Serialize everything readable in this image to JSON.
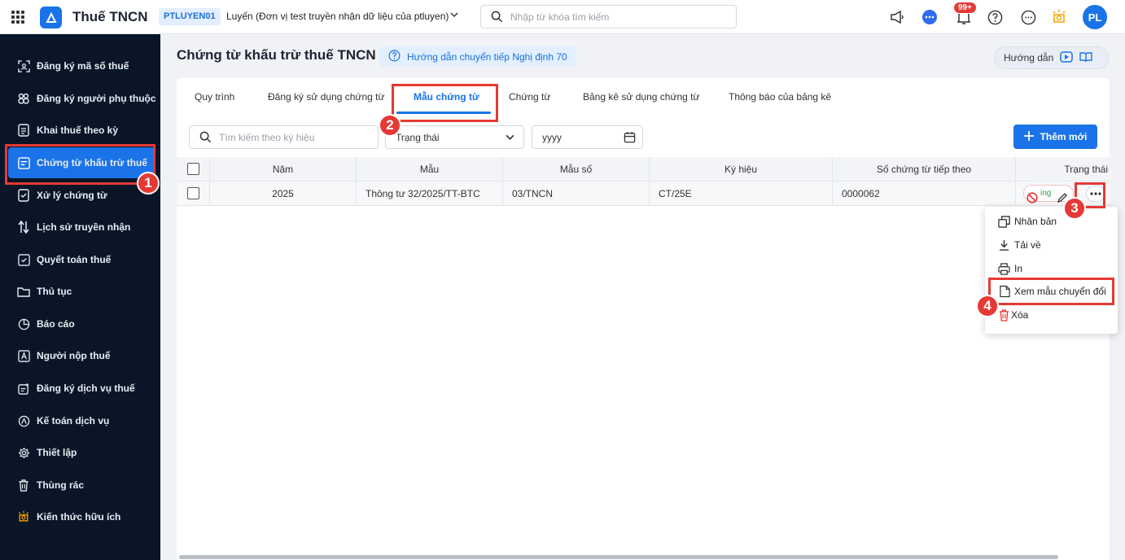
{
  "app": {
    "title": "Thuế TNCN",
    "tax_code": "PTLUYEN01",
    "org_name": "Luyến (Đơn vị test truyền nhận dữ liệu của ptluyen)",
    "search_placeholder": "Nhập từ khóa tìm kiếm",
    "notification_count": "99+",
    "avatar_initials": "PL"
  },
  "sidebar": {
    "items": [
      {
        "label": "Đăng ký mã số thuế",
        "icon": "scan-icon"
      },
      {
        "label": "Đăng ký người phụ thuộc",
        "icon": "people-icon"
      },
      {
        "label": "Khai thuế theo kỳ",
        "icon": "document-icon"
      },
      {
        "label": "Chứng từ khấu trừ thuế",
        "icon": "receipt-icon",
        "active": true
      },
      {
        "label": "Xử lý chứng từ",
        "icon": "doc-check-icon"
      },
      {
        "label": "Lịch sử truyền nhận",
        "icon": "transfer-icon"
      },
      {
        "label": "Quyết toán thuế",
        "icon": "settle-icon"
      },
      {
        "label": "Thủ tục",
        "icon": "folder-icon"
      },
      {
        "label": "Báo cáo",
        "icon": "pie-chart-icon"
      },
      {
        "label": "Người nộp thuế",
        "icon": "taxpayer-icon"
      },
      {
        "label": "Đăng ký dịch vụ thuế",
        "icon": "register-service-icon"
      },
      {
        "label": "Kế toán dịch vụ",
        "icon": "accounting-icon"
      },
      {
        "label": "Thiết lập",
        "icon": "gear-icon"
      },
      {
        "label": "Thùng rác",
        "icon": "trash-icon"
      },
      {
        "label": "Kiến thức hữu ích",
        "icon": "lightbulb-icon"
      }
    ]
  },
  "page": {
    "title": "Chứng từ khấu trừ thuế TNCN",
    "guide_link": "Hướng dẫn chuyển tiếp Nghị định 70",
    "help_label": "Hướng dẫn"
  },
  "tabs": [
    "Quy trình",
    "Đăng ký sử dụng chứng từ",
    "Mẫu chứng từ",
    "Chứng từ",
    "Bảng kê sử dụng chứng từ",
    "Thông báo của bảng kê"
  ],
  "active_tab": "Mẫu chứng từ",
  "filters": {
    "search_placeholder": "Tìm kiếm theo ký hiệu",
    "status_placeholder": "Trạng thái",
    "year_placeholder": "yyyy",
    "add_button": "Thêm mới"
  },
  "table": {
    "columns": [
      "Năm",
      "Mẫu",
      "Mẫu số",
      "Ký hiệu",
      "Số chứng từ tiếp theo",
      "Trạng thái"
    ],
    "rows": [
      {
        "year": "2025",
        "template": "Thông tư 32/2025/TT-BTC",
        "form_no": "03/TNCN",
        "symbol": "CT/25E",
        "next_no": "0000062",
        "status_partial": "ing"
      }
    ]
  },
  "context_menu": {
    "items": [
      {
        "label": "Nhân bản",
        "icon": "duplicate-icon"
      },
      {
        "label": "Tải về",
        "icon": "download-icon"
      },
      {
        "label": "In",
        "icon": "print-icon"
      },
      {
        "label": "Xem mẫu chuyển đổi",
        "icon": "converted-doc-icon"
      },
      {
        "label": "Xóa",
        "icon": "trash-icon"
      }
    ]
  },
  "steps": [
    "1",
    "2",
    "3",
    "4"
  ],
  "colors": {
    "primary": "#1a73e8",
    "sidebar_bg": "#0a1628",
    "highlight": "#e53935"
  }
}
